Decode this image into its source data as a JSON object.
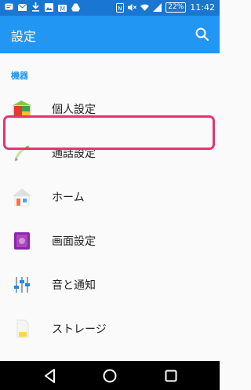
{
  "status": {
    "battery": "22%",
    "time": "11:42"
  },
  "appbar": {
    "title": "設定"
  },
  "section": {
    "header": "機器"
  },
  "items": [
    {
      "label": "個人設定",
      "icon": "personalization-icon"
    },
    {
      "label": "通話設定",
      "icon": "call-settings-icon"
    },
    {
      "label": "ホーム",
      "icon": "home-icon"
    },
    {
      "label": "画面設定",
      "icon": "display-icon"
    },
    {
      "label": "音と通知",
      "icon": "sound-notification-icon"
    },
    {
      "label": "ストレージ",
      "icon": "storage-icon"
    }
  ],
  "colors": {
    "statusbar": "#1976d2",
    "appbar": "#2196f3",
    "highlight": "#e8336f"
  }
}
